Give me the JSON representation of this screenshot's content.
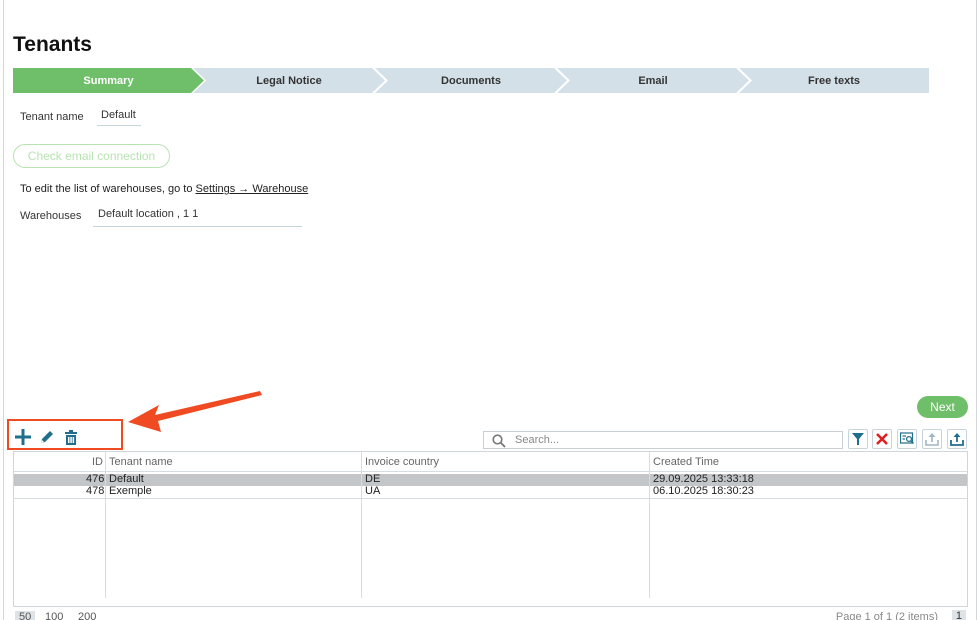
{
  "page": {
    "title": "Tenants"
  },
  "steps": [
    {
      "label": "Summary",
      "active": true
    },
    {
      "label": "Legal Notice",
      "active": false
    },
    {
      "label": "Documents",
      "active": false
    },
    {
      "label": "Email",
      "active": false
    },
    {
      "label": "Free texts",
      "active": false
    }
  ],
  "form": {
    "tenant_name_label": "Tenant name",
    "tenant_name_value": "Default",
    "check_email_label": "Check email connection",
    "info_prefix": "To edit the list of warehouses, go to ",
    "info_link": "Settings → Warehouse",
    "warehouses_label": "Warehouses",
    "warehouses_value": "Default location , 1 1"
  },
  "next_label": "Next",
  "toolbar": {
    "add_icon": "plus-icon",
    "edit_icon": "pencil-icon",
    "delete_icon": "trash-icon",
    "search_placeholder": "Search...",
    "filter_icon": "filter-icon",
    "clear_filter_icon": "close-icon",
    "search_detail_icon": "search-document-icon",
    "export_icon": "upload-icon",
    "export2_icon": "upload-icon"
  },
  "colors": {
    "accent_green": "#6fbf6a",
    "step_inactive": "#d4e0e7",
    "highlight_red": "#f04a22",
    "icon_teal": "#1f6e8c"
  },
  "table": {
    "columns": [
      "ID",
      "Tenant name",
      "Invoice country",
      "Created Time"
    ],
    "rows": [
      {
        "id": "476",
        "name": "Default",
        "country": "DE",
        "created": "29.09.2025 13:33:18",
        "selected": true
      },
      {
        "id": "478",
        "name": "Exemple",
        "country": "UA",
        "created": "06.10.2025 18:30:23",
        "selected": false
      }
    ]
  },
  "pager": {
    "sizes": [
      "50",
      "100",
      "200"
    ],
    "info": "Page 1 of 1 (2 items)",
    "current": "1"
  }
}
